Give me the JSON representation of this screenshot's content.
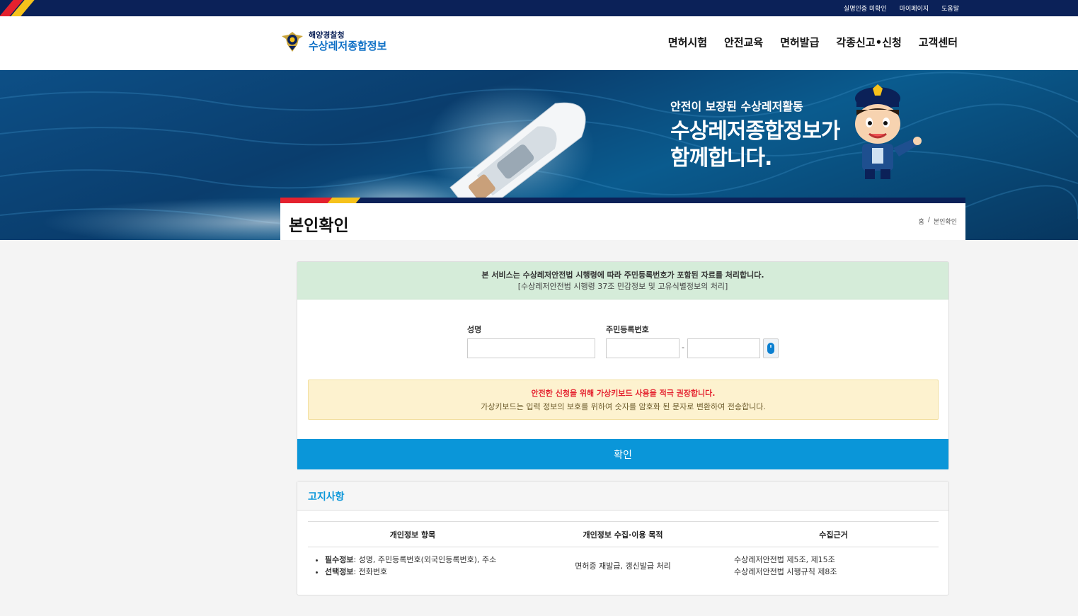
{
  "top_links": [
    "실명인증 미확인",
    "마이페이지",
    "도움말"
  ],
  "logo": {
    "line1": "해양경찰청",
    "line2": "수상레저종합정보"
  },
  "gnb": [
    "면허시험",
    "안전교육",
    "면허발급",
    "각종신고•신청",
    "고객센터"
  ],
  "hero": {
    "line1": "안전이 보장된 수상레저활동",
    "line2": "수상레저종합정보가",
    "line3": "함께합니다."
  },
  "page_title": "본인확인",
  "breadcrumb": {
    "home": "홈",
    "sep": "/",
    "current": "본인확인"
  },
  "notice_green": {
    "line1": "본 서비스는 수상레저안전법 시행령에 따라 주민등록번호가 포함된 자료를 처리합니다.",
    "line2": "[수상레저안전법 시행령 37조 민감정보 및 고유식별정보의 처리]"
  },
  "form": {
    "name_label": "성명",
    "name_value": "",
    "rrn_label": "주민등록번호",
    "rrn_front": "",
    "rrn_back": "",
    "dash": "-"
  },
  "notice_yellow": {
    "line1": "안전한 신청을 위해 가상키보드 사용을 적극 권장합니다.",
    "line2": "가상키보드는 입력 정보의 보호를 위하여 숫자를 암호화 된 문자로 변환하여 전송합니다."
  },
  "confirm_label": "확인",
  "notice_section": {
    "title": "고지사항",
    "headers": [
      "개인정보 항목",
      "개인정보 수집·이용 목적",
      "수집근거"
    ],
    "required_label": "필수정보",
    "required_text": ": 성명, 주민등록번호(외국인등록번호), 주소",
    "optional_label": "선택정보",
    "optional_text": ": 전화번호",
    "purpose": "면허증 재발급, 갱신발급 처리",
    "basis1": "수상레저안전법 제5조, 제15조",
    "basis2": "수상레저안전법 시행규칙 제8조"
  },
  "colors": {
    "navy": "#0b2158",
    "accent_blue": "#0a96d9",
    "red": "#e4212e",
    "yellow": "#f6c21b"
  }
}
